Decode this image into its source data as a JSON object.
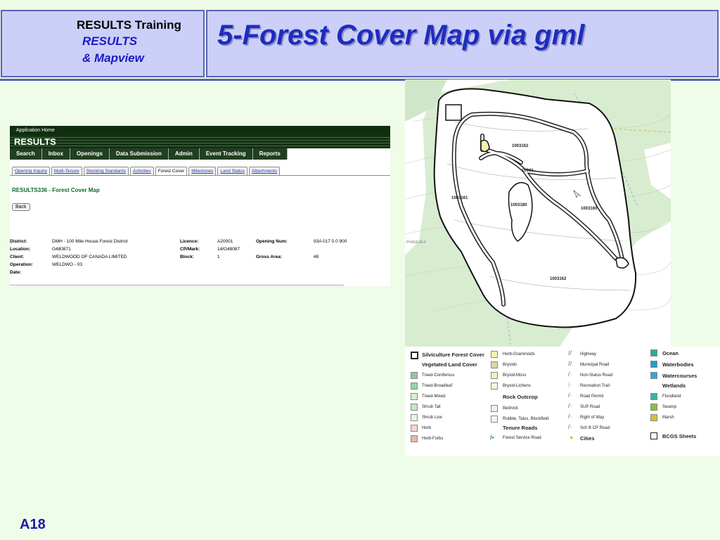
{
  "header": {
    "course": "RESULTS Training",
    "subtitle_1": "RESULTS",
    "subtitle_2": "& Mapview",
    "title": "5-Forest Cover Map via gml"
  },
  "app": {
    "top_link": "· Application Home",
    "banner": "RESULTS",
    "nav": [
      "Search",
      "Inbox",
      "Openings",
      "Data Submission",
      "Admin",
      "Event Tracking",
      "Reports"
    ],
    "tabs": [
      "Opening Inquiry",
      "Multi-Tenure",
      "Stocking Standards",
      "Activities",
      "Forest Cover",
      "Milestones",
      "Land Status",
      "Attachments"
    ],
    "active_tab": "Forest Cover",
    "page_heading": "RESULTS336 - Forest Cover Map",
    "back_button": "Back",
    "fields": {
      "district_label": "District:",
      "district": "DMH - 100 Mile House Forest District",
      "location_label": "Location:",
      "location": "G480871",
      "client_label": "Client:",
      "client": "WELDWOOD OF CANADA LIMITED",
      "operation_label": "Operation:",
      "operation": "WELDWO - 03",
      "date_label": "Date:",
      "licence_label": "Licence:",
      "licence": "A20001",
      "cpmark_label": "CP/Mark:",
      "cpmark": "14/G48087",
      "block_label": "Block:",
      "block": "1",
      "opening_num_label": "Opening Num:",
      "opening_num": "93A 017 0.0 900",
      "gross_area_label": "Gross Area:",
      "gross_area": "48"
    }
  },
  "map": {
    "block_labels": [
      "1003162",
      "1003161",
      "1003180",
      "1003160",
      "1003162",
      "10031"
    ],
    "side_label": "PHASE3G-F",
    "colors": {
      "vegetated": "#d8ecd0",
      "block_fill": "#ffffff",
      "road": "#222222"
    }
  },
  "legend": {
    "col1": {
      "silviculture": "Silviculture Forest Cover",
      "vegetated": "Vegetated Land Cover",
      "items": [
        "Treed-Coniferous",
        "Treed-Broadleaf",
        "Treed-Mixed",
        "Shrub Tall",
        "Shrub Low",
        "Herb",
        "Herb-Forbs"
      ],
      "colors": [
        "#9fbfa8",
        "#8fd6a8",
        "#d8f0d0",
        "#c8e6c0",
        "#eaf4e4",
        "#f4d8c8",
        "#e4b8a4"
      ]
    },
    "col2": {
      "items_top": [
        "Herb-Graminoids",
        "Bryoids",
        "Bryoid-Moss",
        "Bryoid-Lichens"
      ],
      "colors_top": [
        "#f8f0b0",
        "#d8d8a8",
        "#f0f0c0",
        "#f8f4d8"
      ],
      "rock": "Rock Outcrop",
      "items_rock": [
        "Bedrock",
        "Rubble, Talus, Blockfield"
      ],
      "tenure": "Tenure Roads",
      "forest_service_road": "Forest Service Road"
    },
    "col3": {
      "items": [
        "Highway",
        "Municipal Road",
        "Non-Status Road",
        "Recreation Trail",
        "Road Permit",
        "SUP Road",
        "Right of Way",
        "Sch B CP Road"
      ],
      "cities": "Cities"
    },
    "col4": {
      "ocean": "Ocean",
      "waterbodies": "Waterbodies",
      "watercourses": "Watercourses",
      "wetlands": "Wetlands",
      "wet_items": [
        "Floodland",
        "Swamp",
        "Marsh"
      ],
      "bcgs": "BCGS Sheets",
      "colors": {
        "ocean": "#2aa8a0",
        "waterbodies": "#20a0d0",
        "watercourses": "#30a8d8",
        "floodland": "#30b8a0",
        "swamp": "#88c040",
        "marsh": "#d8c030"
      }
    }
  },
  "footer": {
    "code": "A18"
  }
}
